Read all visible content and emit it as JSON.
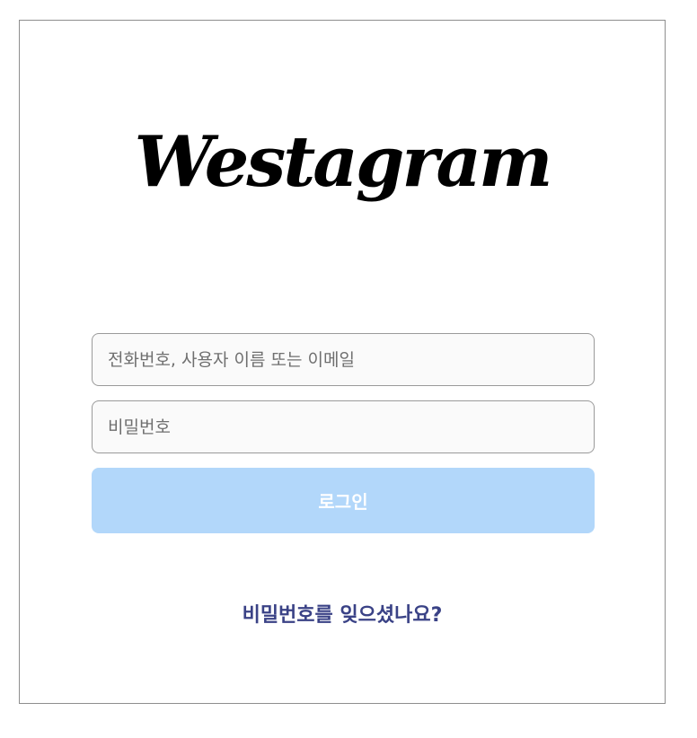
{
  "brand": {
    "logo_text": "Westagram"
  },
  "login_form": {
    "id_placeholder": "전화번호, 사용자 이름 또는 이메일",
    "id_value": "",
    "password_placeholder": "비밀번호",
    "password_value": "",
    "login_label": "로그인",
    "login_button_color": "#b2d7fa",
    "forgot_password_label": "비밀번호를 잊으셨나요?",
    "link_color": "#3a4286"
  }
}
